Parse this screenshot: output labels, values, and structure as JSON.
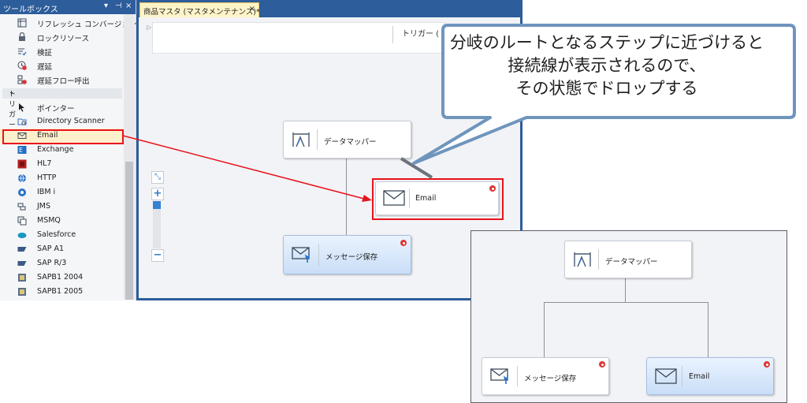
{
  "toolbox": {
    "title": "ツールボックス",
    "controls": [
      "▾",
      "⊣",
      "×"
    ],
    "items_top": [
      {
        "label": "リフレッシュ コンバージョン",
        "icon": "refresh-conversion-icon"
      },
      {
        "label": "ロックリソース",
        "icon": "lock-icon"
      },
      {
        "label": "検証",
        "icon": "validate-icon"
      },
      {
        "label": "遅延",
        "icon": "delay-icon"
      },
      {
        "label": "遅延フロー呼出",
        "icon": "delay-flow-icon"
      }
    ],
    "section": "トリガー",
    "triggers": [
      {
        "label": "ポインター",
        "icon": "pointer-icon"
      },
      {
        "label": "Directory Scanner",
        "icon": "directory-scanner-icon"
      },
      {
        "label": "Email",
        "icon": "email-icon"
      },
      {
        "label": "Exchange",
        "icon": "exchange-icon"
      },
      {
        "label": "HL7",
        "icon": "hl7-icon"
      },
      {
        "label": "HTTP",
        "icon": "http-icon"
      },
      {
        "label": "IBM i",
        "icon": "ibm-i-icon"
      },
      {
        "label": "JMS",
        "icon": "jms-icon"
      },
      {
        "label": "MSMQ",
        "icon": "msmq-icon"
      },
      {
        "label": "Salesforce",
        "icon": "salesforce-icon"
      },
      {
        "label": "SAP A1",
        "icon": "sap-a1-icon"
      },
      {
        "label": "SAP R/3",
        "icon": "sap-r3-icon"
      },
      {
        "label": "SAPB1 2004",
        "icon": "sapb1-icon"
      },
      {
        "label": "SAPB1 2005",
        "icon": "sapb1-icon"
      }
    ]
  },
  "designer": {
    "tab_label": "商品マスタ (マスタメンテナンス)*",
    "tab_close": "×",
    "trigger_text": "トリガー (",
    "zoom": {
      "fit": "⤡",
      "plus": "+",
      "minus": "−"
    },
    "nodes": {
      "data_mapper": "データマッパー",
      "email": "Email",
      "save_message": "メッセージ保存"
    }
  },
  "callout": {
    "lines": [
      "分岐のルートとなるステップに近づけると",
      "接続線が表示されるので、",
      "その状態でドロップする"
    ]
  },
  "result": {
    "nodes": {
      "data_mapper": "データマッパー",
      "save_message": "メッセージ保存",
      "email": "Email"
    }
  },
  "colors": {
    "accent": "#2d5d9a",
    "highlight": "#e8121c",
    "callout_border": "#6f95bd",
    "tab_active": "#fff4c8",
    "gear": "#e03434"
  }
}
